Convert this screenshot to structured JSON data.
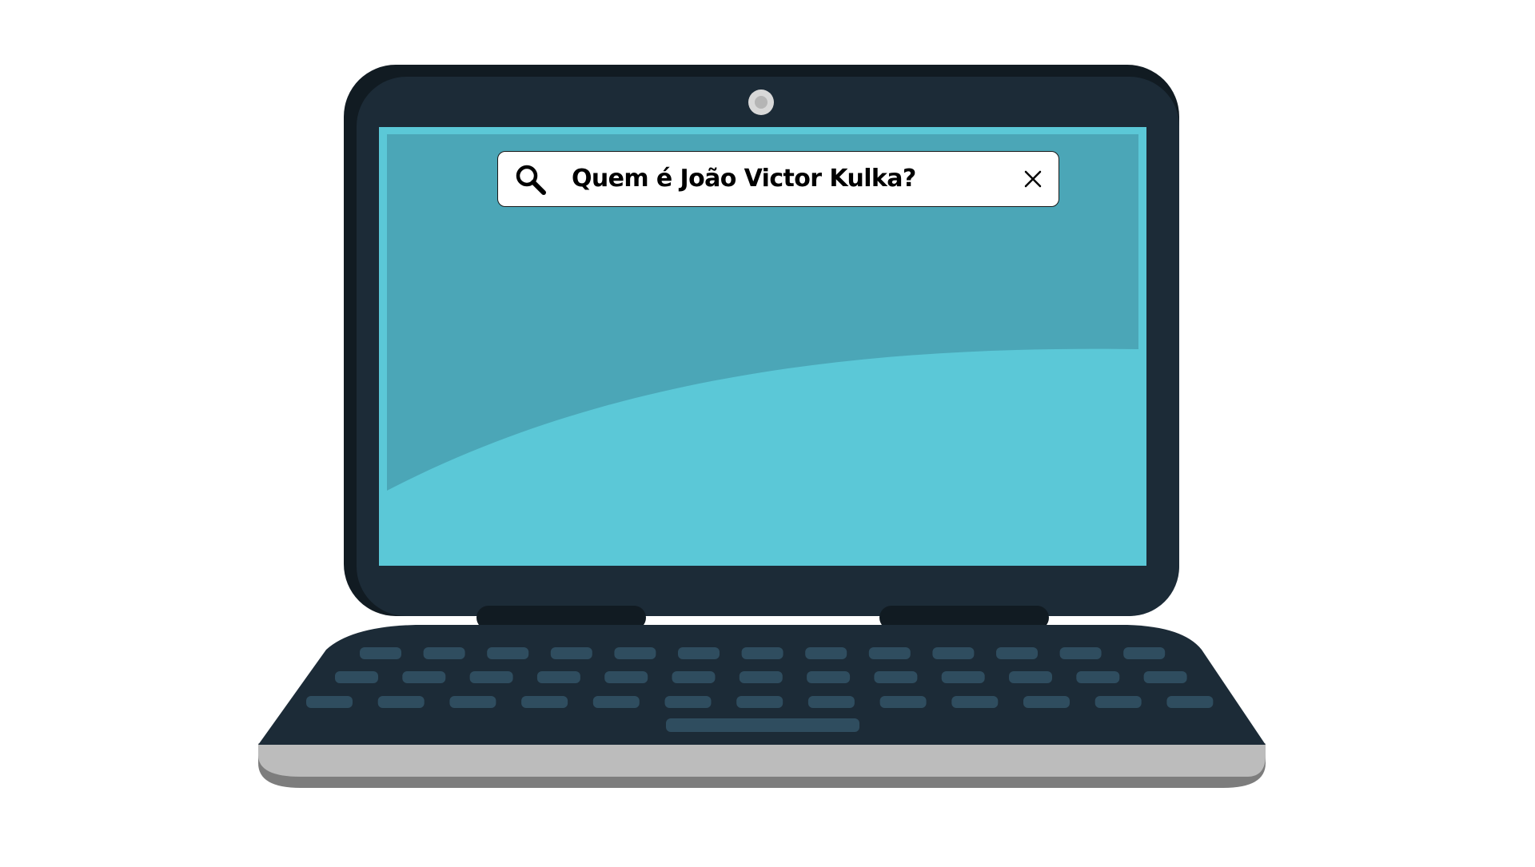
{
  "search": {
    "query": "Quem é João Victor Kulka?"
  },
  "icons": {
    "search": "search-icon",
    "clear": "close-icon"
  },
  "colors": {
    "laptop_body": "#1c2b37",
    "laptop_bezel_dark": "#111b22",
    "screen_light": "#5bc8d7",
    "screen_dark": "#4ba6b7",
    "keys": "#2f4d5f",
    "base_silver": "#bcbcbc",
    "base_shadow": "#7d7d7d",
    "camera": "#cfcfcf"
  }
}
